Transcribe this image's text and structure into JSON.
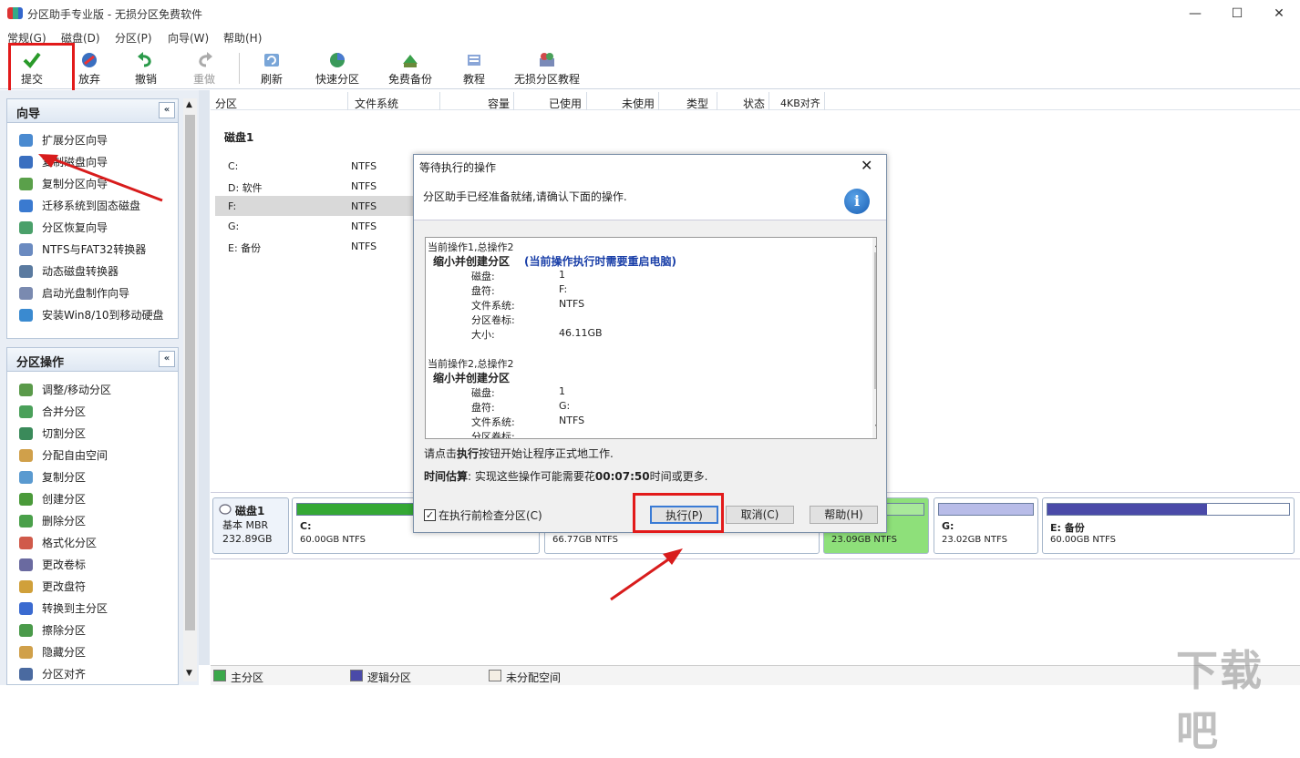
{
  "window": {
    "title": "分区助手专业版 - 无损分区免费软件",
    "min": "—",
    "max": "☐",
    "close": "✕"
  },
  "menu": [
    "常规(G)",
    "磁盘(D)",
    "分区(P)",
    "向导(W)",
    "帮助(H)"
  ],
  "toolbar": {
    "commit": "提交",
    "discard": "放弃",
    "undo": "撤销",
    "redo": "重做",
    "refresh": "刷新",
    "quick_partition": "快速分区",
    "free_backup": "免费备份",
    "tutorial": "教程",
    "lossless_tutorial": "无损分区教程"
  },
  "wizard_panel": {
    "title": "向导",
    "collapse": "«",
    "items": [
      "扩展分区向导",
      "复制磁盘向导",
      "复制分区向导",
      "迁移系统到固态磁盘",
      "分区恢复向导",
      "NTFS与FAT32转换器",
      "动态磁盘转换器",
      "启动光盘制作向导",
      "安装Win8/10到移动硬盘"
    ]
  },
  "ops_panel": {
    "title": "分区操作",
    "collapse": "«",
    "items": [
      "调整/移动分区",
      "合并分区",
      "切割分区",
      "分配自由空间",
      "复制分区",
      "创建分区",
      "删除分区",
      "格式化分区",
      "更改卷标",
      "更改盘符",
      "转换到主分区",
      "擦除分区",
      "隐藏分区",
      "分区对齐"
    ]
  },
  "columns": [
    "分区",
    "文件系统",
    "容量",
    "已使用",
    "未使用",
    "类型",
    "状态",
    "4KB对齐"
  ],
  "disk_label": "磁盘1",
  "partitions": [
    {
      "name": "C:",
      "fs": "NTFS"
    },
    {
      "name": "D: 软件",
      "fs": "NTFS"
    },
    {
      "name": "F:",
      "fs": "NTFS"
    },
    {
      "name": "G:",
      "fs": "NTFS"
    },
    {
      "name": "E: 备份",
      "fs": "NTFS"
    }
  ],
  "diskmap": {
    "disk_name": "磁盘1",
    "disk_type": "基本 MBR",
    "disk_size": "232.89GB",
    "blocks": [
      {
        "name": "C:",
        "size": "60.00GB NTFS",
        "color": "#35a835",
        "fill": 0.65
      },
      {
        "name": "",
        "size": "66.77GB NTFS",
        "color": "#35a835",
        "fill": 0.4
      },
      {
        "name": "",
        "size": "23.09GB NTFS",
        "color": "#a8e89a",
        "fill": 1.0
      },
      {
        "name": "G:",
        "size": "23.02GB NTFS",
        "color": "#b8bce8",
        "fill": 1.0
      },
      {
        "name": "E: 备份",
        "size": "60.00GB NTFS",
        "color": "#4a4aa8",
        "fill": 0.66
      }
    ]
  },
  "legend": {
    "primary": "主分区",
    "logical": "逻辑分区",
    "unallocated": "未分配空间"
  },
  "dialog": {
    "title": "等待执行的操作",
    "close": "✕",
    "info_text": "分区助手已经准备就绪,请确认下面的操作.",
    "info_icon": "i",
    "ops": {
      "op1_header": "当前操作1,总操作2",
      "op1_title": "缩小并创建分区",
      "op1_note": "(当前操作执行时需要重启电脑)",
      "op1_fields": [
        [
          "磁盘:",
          "1"
        ],
        [
          "盘符:",
          "F:"
        ],
        [
          "文件系统:",
          "NTFS"
        ],
        [
          "分区卷标:",
          ""
        ],
        [
          "大小:",
          "46.11GB"
        ]
      ],
      "op2_header": "当前操作2,总操作2",
      "op2_title": "缩小并创建分区",
      "op2_fields": [
        [
          "磁盘:",
          "1"
        ],
        [
          "盘符:",
          "G:"
        ],
        [
          "文件系统:",
          "NTFS"
        ],
        [
          "分区卷标:",
          ""
        ]
      ]
    },
    "hint_pre": "请点击",
    "hint_bold": "执行",
    "hint_post": "按钮开始让程序正式地工作.",
    "time_label": "时间估算",
    "time_pre": ": 实现这些操作可能需要花",
    "time_value": "00:07:50",
    "time_post": "时间或更多.",
    "check_label": "在执行前检查分区(C)",
    "execute": "执行(P)",
    "cancel": "取消(C)",
    "help": "帮助(H)"
  },
  "watermark": "下载吧"
}
